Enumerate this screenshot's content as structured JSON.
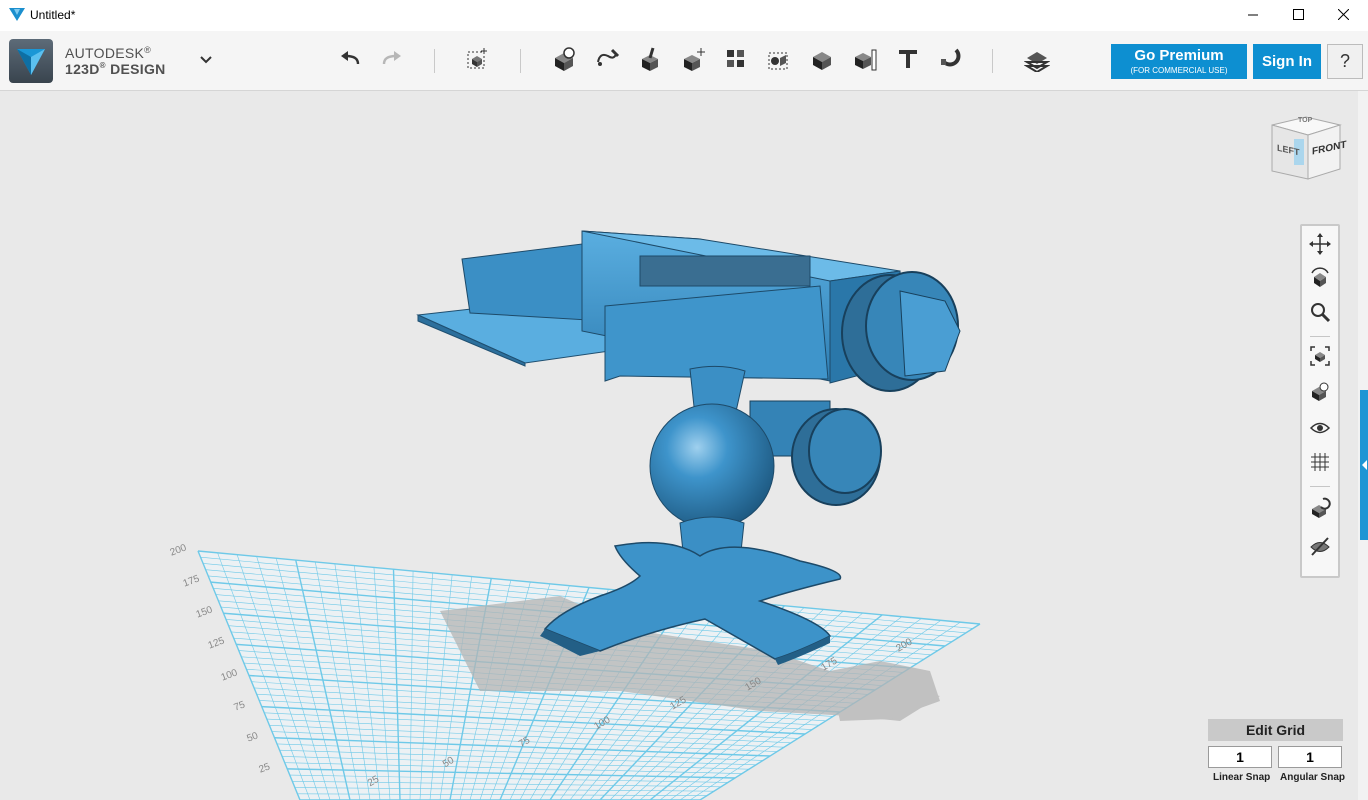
{
  "window": {
    "title": "Untitled*"
  },
  "app": {
    "brand_line1": "AUTODESK",
    "brand_line2": "123D",
    "brand_line3": "DESIGN"
  },
  "toolbar": {
    "tools": [
      {
        "name": "undo",
        "icon": "undo-icon"
      },
      {
        "name": "redo",
        "icon": "redo-icon"
      },
      {
        "name": "transform",
        "icon": "transform-icon"
      },
      {
        "name": "primitives",
        "icon": "primitives-icon"
      },
      {
        "name": "sketch",
        "icon": "sketch-icon"
      },
      {
        "name": "construct",
        "icon": "construct-icon"
      },
      {
        "name": "modify",
        "icon": "modify-icon"
      },
      {
        "name": "pattern",
        "icon": "pattern-icon"
      },
      {
        "name": "grouping",
        "icon": "grouping-icon"
      },
      {
        "name": "combine",
        "icon": "combine-icon"
      },
      {
        "name": "measure",
        "icon": "measure-icon"
      },
      {
        "name": "text",
        "icon": "text-icon"
      },
      {
        "name": "snap",
        "icon": "snap-magnet-icon"
      },
      {
        "name": "material",
        "icon": "material-icon"
      }
    ],
    "premium_label": "Go Premium",
    "premium_sub": "(FOR COMMERCIAL USE)",
    "signin_label": "Sign In",
    "help_label": "?"
  },
  "viewcube": {
    "left": "LEFT",
    "front": "FRONT",
    "top": "TOP"
  },
  "navigation": [
    {
      "name": "pan",
      "icon": "pan-icon"
    },
    {
      "name": "orbit",
      "icon": "orbit-icon"
    },
    {
      "name": "zoom",
      "icon": "zoom-icon"
    },
    {
      "name": "fit",
      "icon": "fit-to-view-icon"
    },
    {
      "name": "view-selected",
      "icon": "view-selected-icon"
    },
    {
      "name": "visibility",
      "icon": "eye-icon"
    },
    {
      "name": "materials-outline",
      "icon": "grid-view-icon"
    },
    {
      "name": "snap-to",
      "icon": "snap-icon"
    },
    {
      "name": "hide-show",
      "icon": "hide-icon"
    }
  ],
  "grid": {
    "labels_left": [
      "200",
      "175",
      "150",
      "125",
      "100",
      "75",
      "50",
      "25"
    ],
    "labels_front": [
      "25",
      "50",
      "75",
      "100",
      "125",
      "150",
      "175",
      "200"
    ],
    "colors": {
      "grid_line": "#6ec9e8",
      "model": "#3d93c9",
      "model_dark": "#235f86"
    }
  },
  "grid_panel": {
    "edit_grid_label": "Edit Grid",
    "linear_snap_value": "1",
    "angular_snap_value": "1",
    "linear_snap_label": "Linear Snap",
    "angular_snap_label": "Angular Snap"
  }
}
